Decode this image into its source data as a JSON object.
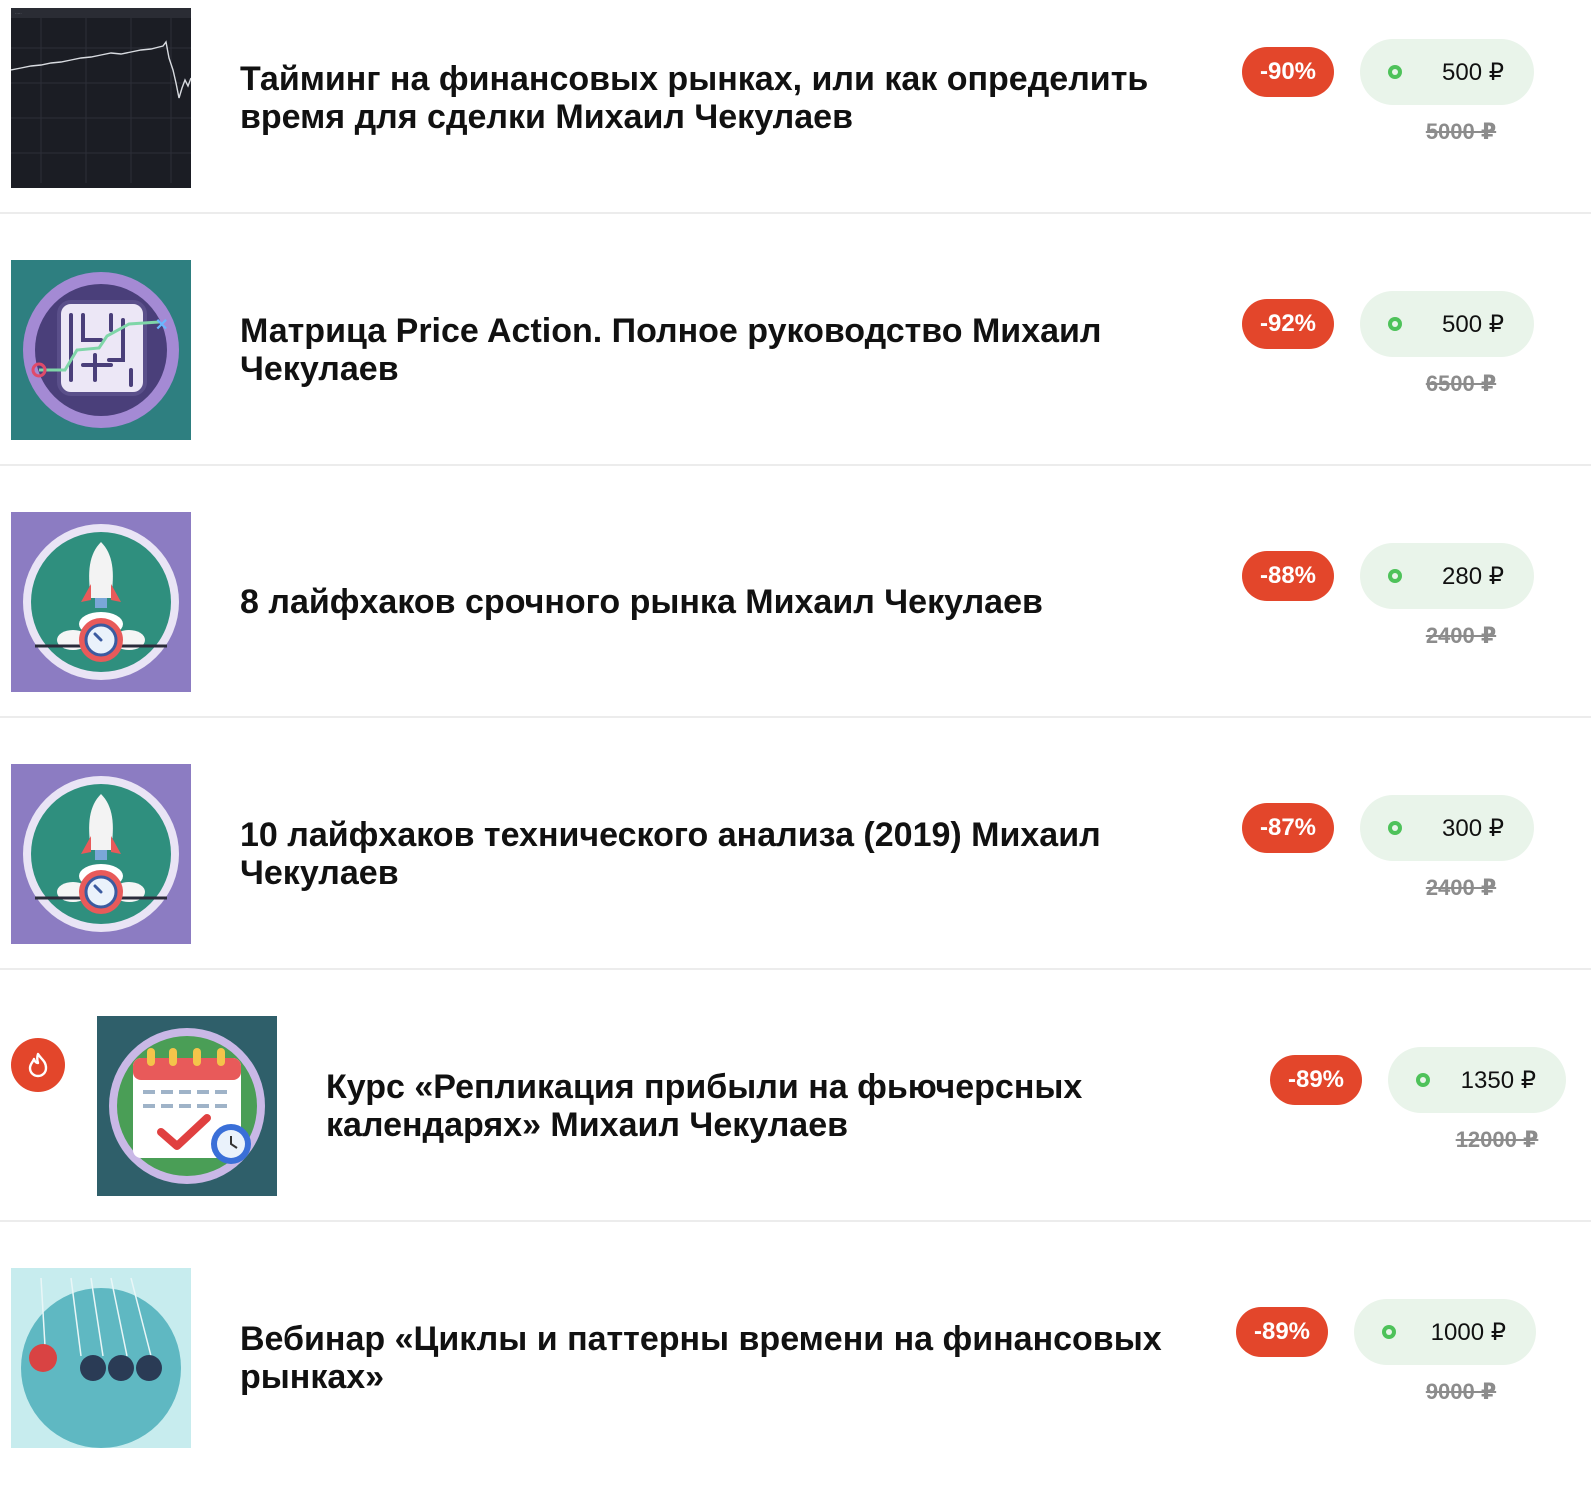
{
  "products": [
    {
      "title": "Тайминг на финансовых рынках, или как определить время для сделки Михаил Чекулаев",
      "discount": "-90%",
      "price": "500 ₽",
      "old_price": "5000 ₽",
      "image": "stock-chart-image",
      "hot": false
    },
    {
      "title": "Матрица Price Action. Полное руководство Михаил Чекулаев",
      "discount": "-92%",
      "price": "500 ₽",
      "old_price": "6500 ₽",
      "image": "maze-image",
      "hot": false
    },
    {
      "title": "8 лайфхаков срочного рынка Михаил Чекулаев",
      "discount": "-88%",
      "price": "280 ₽",
      "old_price": "2400 ₽",
      "image": "rocket-timer-image",
      "hot": false
    },
    {
      "title": "10 лайфхаков технического анализа (2019) Михаил Чекулаев",
      "discount": "-87%",
      "price": "300 ₽",
      "old_price": "2400 ₽",
      "image": "rocket-timer-image",
      "hot": false
    },
    {
      "title": "Курс «Репликация прибыли на фьючерсных календарях» Михаил Чекулаев",
      "discount": "-89%",
      "price": "1350 ₽",
      "old_price": "12000 ₽",
      "image": "calendar-check-image",
      "hot": true
    },
    {
      "title": "Вебинар «Циклы и паттерны времени на финансовых рынках»",
      "discount": "-89%",
      "price": "1000 ₽",
      "old_price": "9000 ₽",
      "image": "newton-cradle-image",
      "hot": false
    }
  ],
  "colors": {
    "discount_badge": "#e3462b",
    "price_pill": "#e9f4ea",
    "price_dot": "#4ec25a",
    "old_price": "#8c8c8c"
  }
}
